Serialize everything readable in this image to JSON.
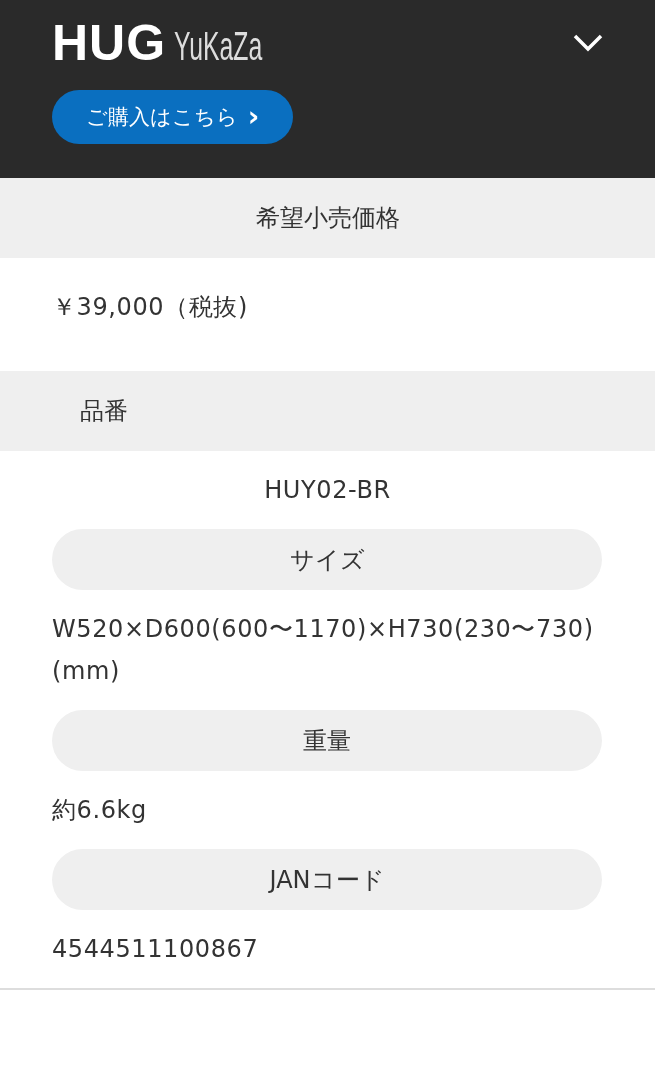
{
  "header": {
    "logo": {
      "mark": "HUG",
      "sub": "YuKaZa"
    },
    "buy_button": {
      "label": "ご購入はこちら",
      "arrow": "›"
    }
  },
  "specs": [
    {
      "kind": "band",
      "label": "希望小売価格",
      "value": "￥39,000（税抜)"
    },
    {
      "kind": "band-left",
      "label": "品番",
      "value": "HUY02-BR"
    },
    {
      "kind": "pill",
      "label": "サイズ",
      "value": "W520×D600(600〜1170)×H730(230〜730) (mm)"
    },
    {
      "kind": "pill",
      "label": "重量",
      "value": "約6.6kg"
    },
    {
      "kind": "pill",
      "label": "JANコード",
      "value": "4544511100867"
    }
  ]
}
